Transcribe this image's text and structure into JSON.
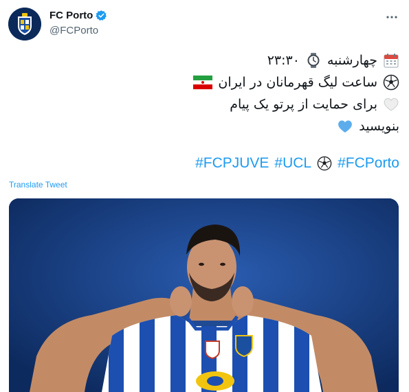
{
  "account": {
    "display_name": "FC Porto",
    "handle": "@FCPorto",
    "verified": true,
    "avatar_icon": "fc-porto-crest-icon"
  },
  "tweet": {
    "lines": [
      {
        "text": "چهارشنبه",
        "time": "۲۳:۳۰",
        "icons": [
          "calendar-icon",
          "watch-icon"
        ]
      },
      {
        "text": "ساعت لیگ قهرمانان در ایران",
        "icons": [
          "soccer-ball-icon",
          "iran-flag-icon"
        ]
      },
      {
        "text": "برای حمایت از پرتو یک پیام",
        "icons": [
          "white-heart-icon"
        ]
      },
      {
        "text": "بنویسید",
        "icons": [
          "blue-heart-icon"
        ]
      }
    ],
    "hashtags": [
      "#FCPJUVE",
      "#UCL",
      "#FCPorto"
    ],
    "translate_label": "Translate Tweet"
  },
  "colors": {
    "link": "#1d9bf0",
    "text": "#0f1419",
    "secondary": "#536471",
    "photo_bg": "#133b7a"
  }
}
